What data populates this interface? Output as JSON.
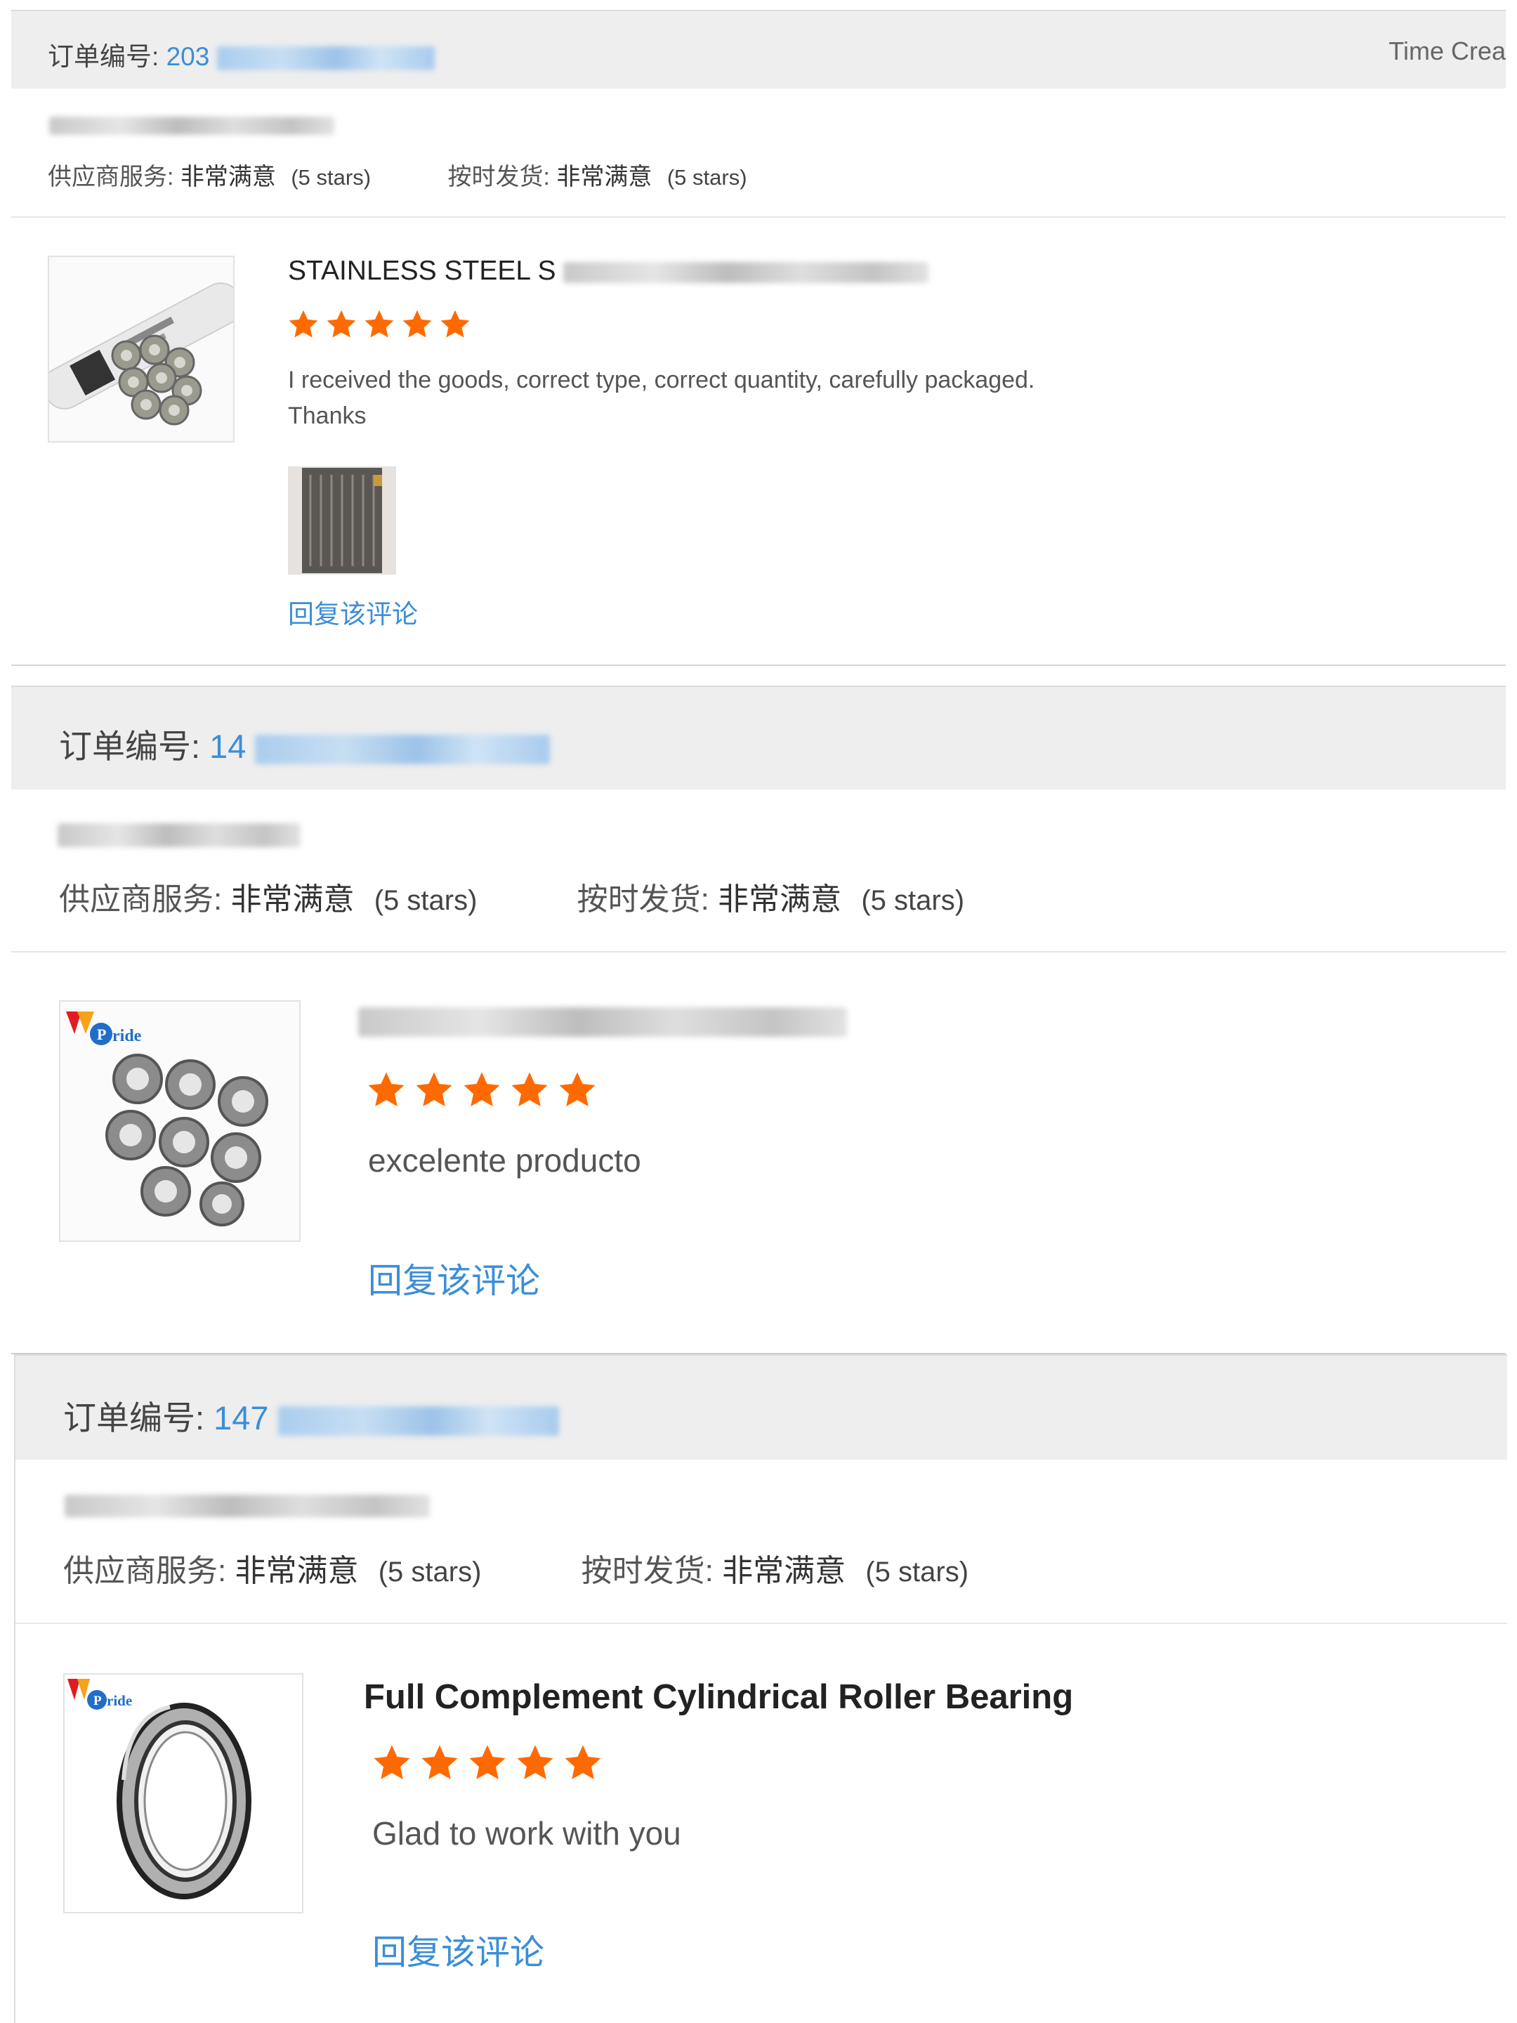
{
  "reviews": [
    {
      "order_label": "订单编号:",
      "order_number_visible": "203",
      "time_label": "Time Crea",
      "supplier_service_label": "供应商服务:",
      "supplier_service_value": "非常满意",
      "supplier_service_stars": "(5 stars)",
      "on_time_label": "按时发货:",
      "on_time_value": "非常满意",
      "on_time_stars": "(5 stars)",
      "product_title": "STAINLESS STEEL S",
      "rating": 5,
      "comment": "I received the goods, correct type, correct quantity, carefully packaged.\n Thanks",
      "reply_label": "回复该评论"
    },
    {
      "order_label": "订单编号:",
      "order_number_visible": "14",
      "supplier_service_label": "供应商服务:",
      "supplier_service_value": "非常满意",
      "supplier_service_stars": "(5 stars)",
      "on_time_label": "按时发货:",
      "on_time_value": "非常满意",
      "on_time_stars": "(5 stars)",
      "product_title": "",
      "rating": 5,
      "comment": "excelente producto",
      "reply_label": "回复该评论",
      "thumb_brand": "Pride"
    },
    {
      "order_label": "订单编号:",
      "order_number_visible": "147",
      "supplier_service_label": "供应商服务:",
      "supplier_service_value": "非常满意",
      "supplier_service_stars": "(5 stars)",
      "on_time_label": "按时发货:",
      "on_time_value": "非常满意",
      "on_time_stars": "(5 stars)",
      "product_title": "Full Complement Cylindrical Roller Bearing",
      "rating": 5,
      "comment": "Glad to work with you",
      "reply_label": "回复该评论",
      "thumb_brand": "Pride"
    }
  ],
  "colors": {
    "link": "#3b8ed8",
    "star": "#ff6a00",
    "header_bg": "#eeeeee"
  },
  "icons": {
    "star": "star-icon",
    "logo": "pride-logo-icon"
  }
}
